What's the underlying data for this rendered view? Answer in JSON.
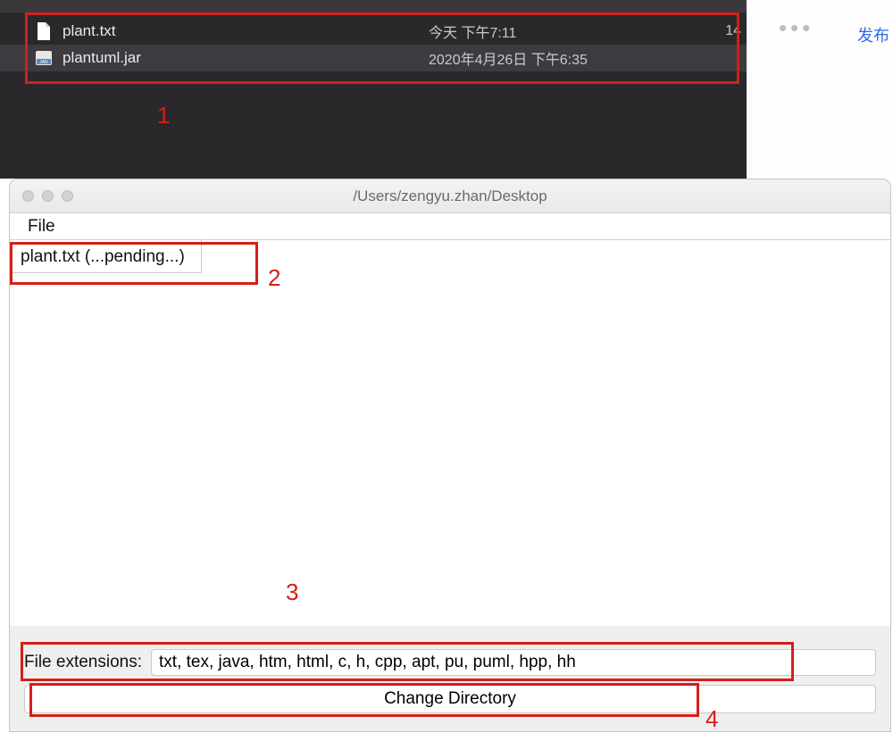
{
  "finder": {
    "rows": [
      {
        "name": "plant.txt",
        "date": "今天 下午7:11",
        "size": "14"
      },
      {
        "name": "plantuml.jar",
        "date": "2020年4月26日 下午6:35",
        "size": ""
      }
    ]
  },
  "rightStrip": {
    "ellipsis": "•••",
    "publish": "发布"
  },
  "annotations": {
    "n1": "1",
    "n2": "2",
    "n3": "3",
    "n4": "4"
  },
  "javaWindow": {
    "title": "/Users/zengyu.zhan/Desktop",
    "menu": {
      "file": "File"
    },
    "tab": "plant.txt (...pending...)",
    "extLabel": "File extensions:",
    "extValue": "txt, tex, java, htm, html, c, h, cpp, apt, pu, puml, hpp, hh",
    "changeDir": "Change Directory"
  }
}
